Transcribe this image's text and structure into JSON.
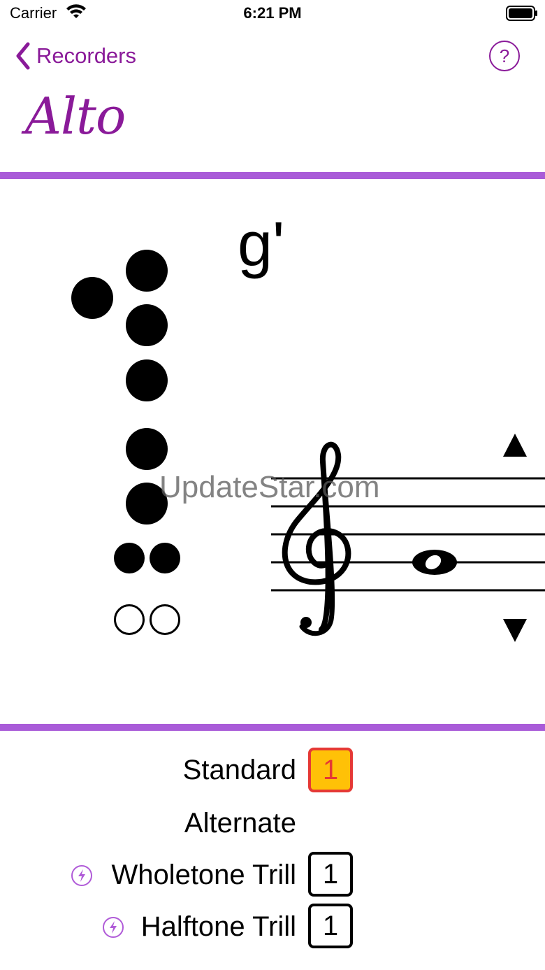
{
  "status_bar": {
    "carrier": "Carrier",
    "time": "6:21 PM"
  },
  "nav": {
    "back_label": "Recorders",
    "help_label": "?"
  },
  "title": "Alto",
  "note": {
    "name": "g'",
    "staff_note": "g'"
  },
  "fingering": {
    "thumb": "closed",
    "holes": [
      "closed",
      "closed",
      "closed",
      "closed",
      "closed"
    ],
    "double_holes": [
      [
        "closed",
        "closed"
      ],
      [
        "open",
        "open"
      ]
    ]
  },
  "watermark": "UpdateStar.com",
  "options": [
    {
      "label": "Standard",
      "value": "1",
      "selected": true,
      "trill_icon": false
    },
    {
      "label": "Alternate",
      "value": "",
      "selected": false,
      "trill_icon": false
    },
    {
      "label": "Wholetone Trill",
      "value": "1",
      "selected": false,
      "trill_icon": true
    },
    {
      "label": "Halftone Trill",
      "value": "1",
      "selected": false,
      "trill_icon": true
    }
  ],
  "colors": {
    "accent": "#8a1a99",
    "divider": "#a95bd8",
    "selected_fill": "#ffc107",
    "selected_border": "#e53935"
  },
  "icons": {
    "back": "chevron-left-icon",
    "help": "question-circle-icon",
    "up": "triangle-up-icon",
    "down": "triangle-down-icon",
    "trill": "bolt-icon"
  }
}
